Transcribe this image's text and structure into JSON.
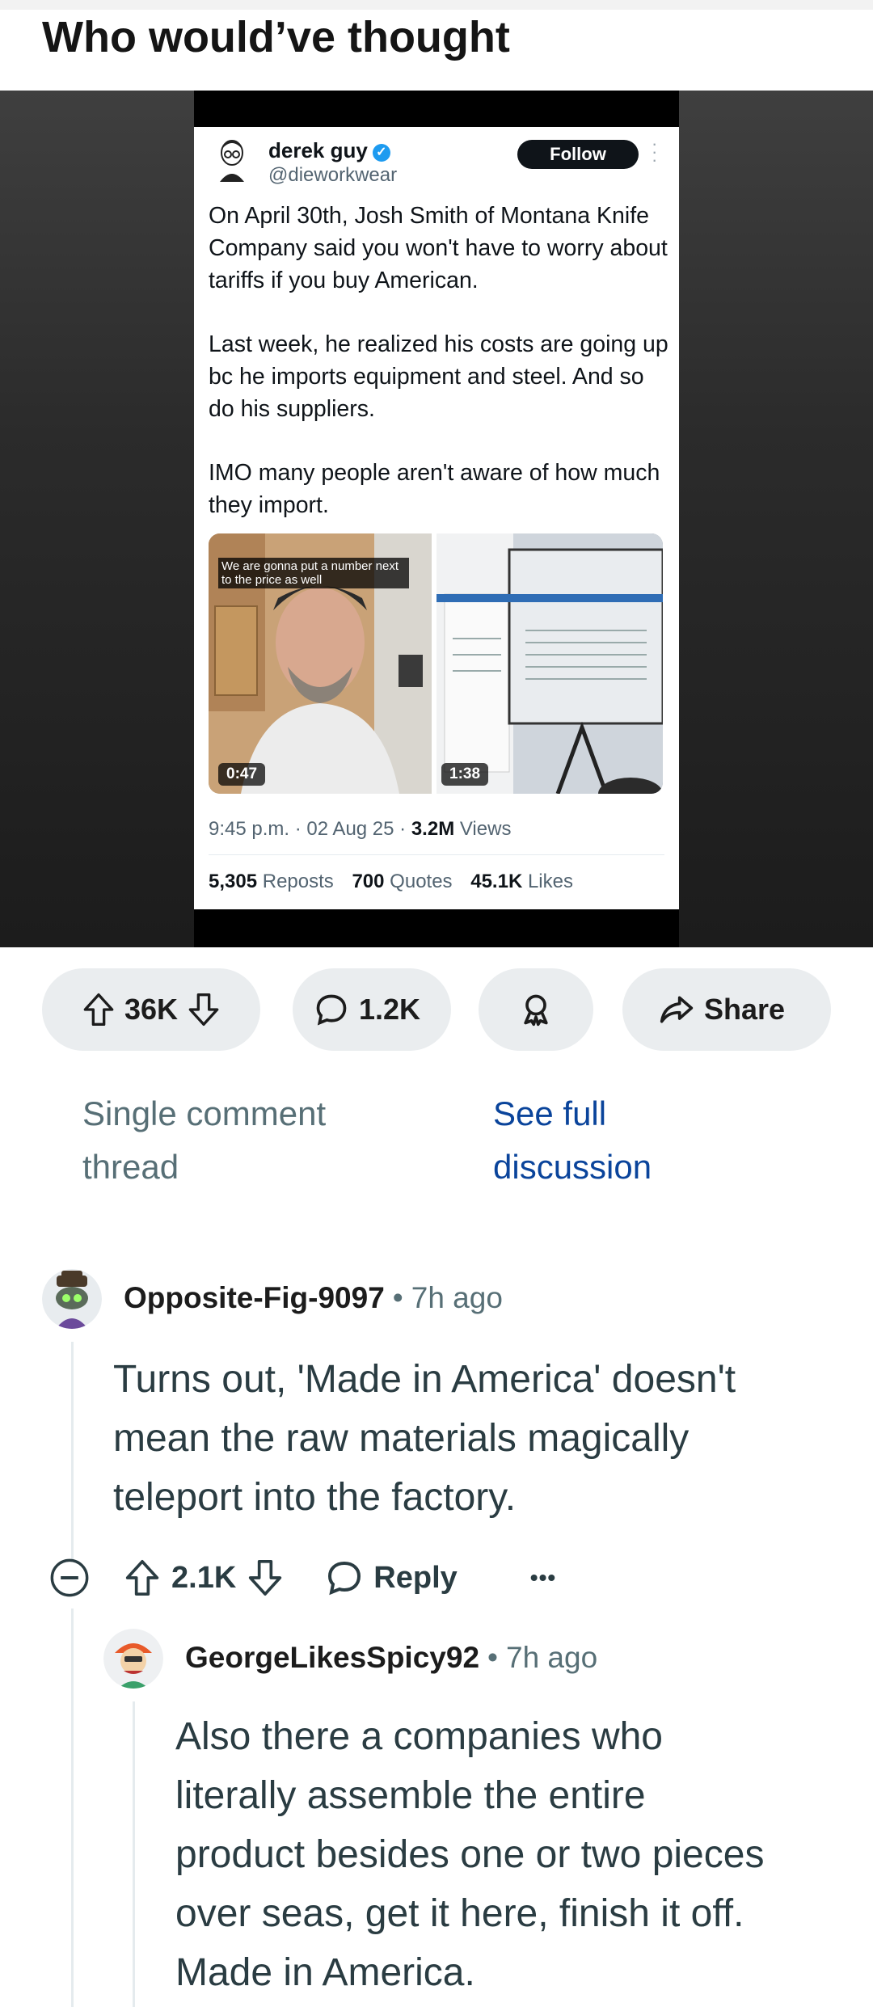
{
  "post": {
    "title": "Who would’ve thought"
  },
  "tweet": {
    "name": "derek guy",
    "handle": "@dieworkwear",
    "follow_label": "Follow",
    "paragraphs": [
      "On April 30th, Josh Smith of Montana Knife Company said you won't have to worry about tariffs if you buy American.",
      "Last week, he realized his costs are going up bc he imports equipment and steel. And so do his suppliers.",
      "IMO many people aren't aware of how much they import."
    ],
    "video1_caption": "We are gonna put a number next to the price as well",
    "video1_duration": "0:47",
    "video2_duration": "1:38",
    "time": "9:45 p.m.",
    "date": "02 Aug 25",
    "views_count": "3.2M",
    "views_label": "Views",
    "reposts_count": "5,305",
    "reposts_label": "Reposts",
    "quotes_count": "700",
    "quotes_label": "Quotes",
    "likes_count": "45.1K",
    "likes_label": "Likes"
  },
  "actions": {
    "votes": "36K",
    "comments": "1.2K",
    "share_label": "Share"
  },
  "thread_links": {
    "single_line1": "Single comment",
    "single_line2": "thread",
    "full_line1": "See full",
    "full_line2": "discussion"
  },
  "comments": [
    {
      "author": "Opposite-Fig-9097",
      "time": "7h ago",
      "lines": [
        "Turns out, 'Made in America' doesn't",
        "mean the raw materials magically",
        "teleport into the factory."
      ],
      "votes": "2.1K",
      "reply_label": "Reply",
      "more": "•••"
    },
    {
      "author": "GeorgeLikesSpicy92",
      "time": "7h ago",
      "lines": [
        "Also there a companies who",
        "literally assemble the entire",
        "product besides one or two pieces",
        "over seas, get it here, finish it off.",
        "Made in America."
      ]
    }
  ]
}
